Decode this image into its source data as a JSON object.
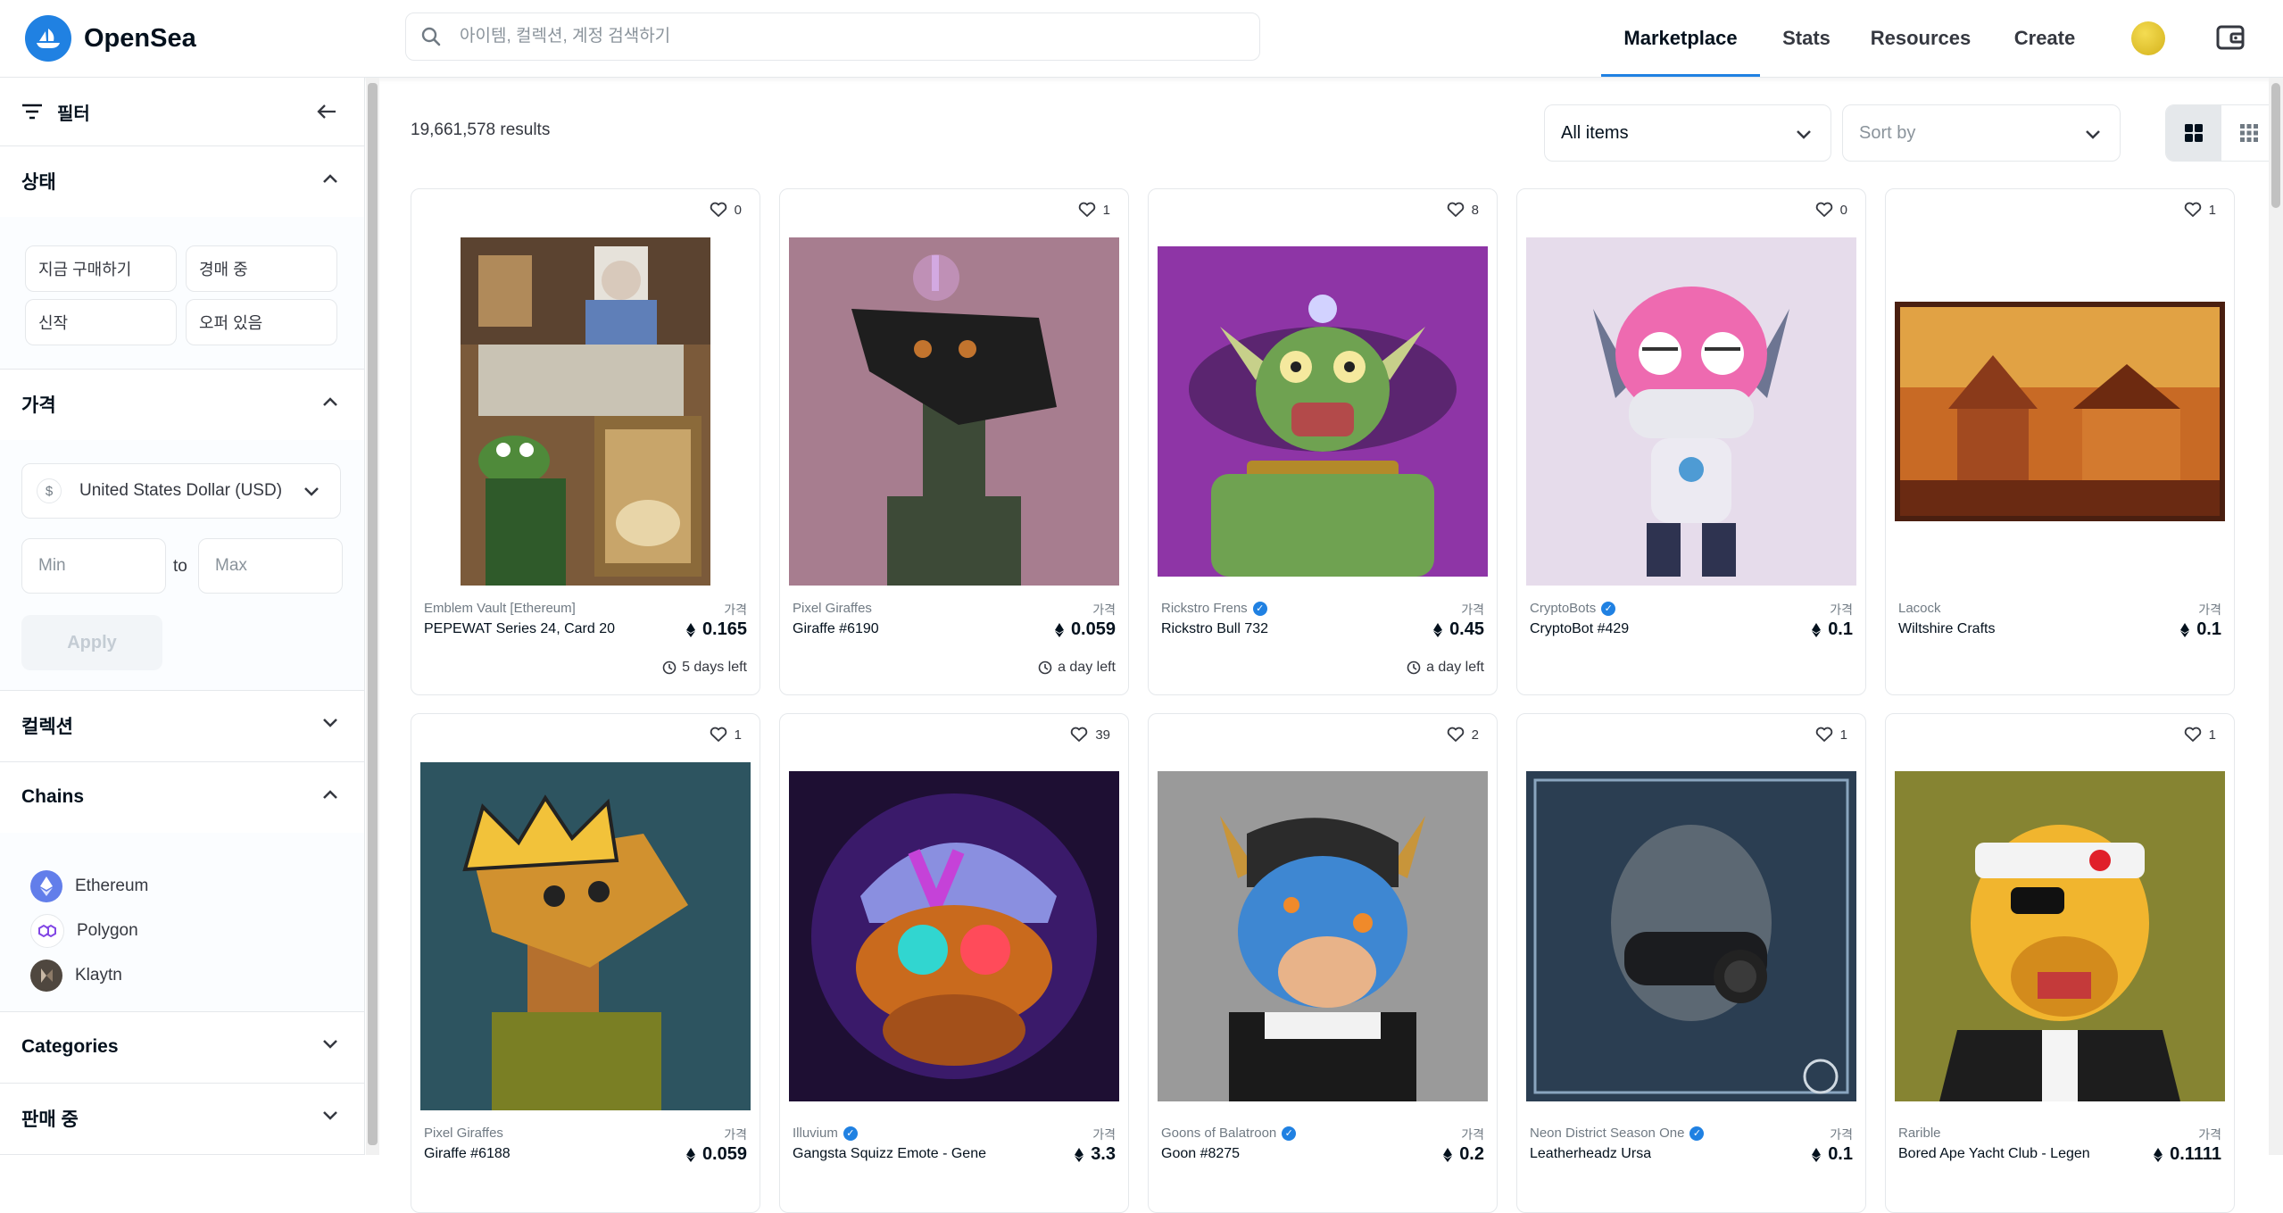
{
  "header": {
    "brand": "OpenSea",
    "search_placeholder": "아이템, 컬렉션, 계정 검색하기",
    "nav": [
      "Marketplace",
      "Stats",
      "Resources",
      "Create"
    ]
  },
  "sidebar": {
    "filter_title": "필터",
    "status": {
      "title": "상태",
      "options": [
        "지금 구매하기",
        "경매 중",
        "신작",
        "오퍼 있음"
      ]
    },
    "price": {
      "title": "가격",
      "currency": "United States Dollar (USD)",
      "currency_symbol": "$",
      "min_placeholder": "Min",
      "max_placeholder": "Max",
      "to_label": "to",
      "apply_label": "Apply"
    },
    "collections_title": "컬렉션",
    "chains": {
      "title": "Chains",
      "items": [
        "Ethereum",
        "Polygon",
        "Klaytn"
      ]
    },
    "categories_title": "Categories",
    "on_sale_title": "판매 중"
  },
  "main": {
    "results_count": "19,661,578 results",
    "items_filter": "All items",
    "sort_placeholder": "Sort by",
    "price_label": "가격",
    "cards": [
      {
        "favorites": "0",
        "collection": "Emblem Vault [Ethereum]",
        "verified": false,
        "name": "PEPEWAT Series 24, Card 20",
        "price": "0.165",
        "time_left": "5 days left",
        "image": "pepe-painting"
      },
      {
        "favorites": "1",
        "collection": "Pixel Giraffes",
        "verified": false,
        "name": "Giraffe #6190",
        "price": "0.059",
        "time_left": "a day left",
        "image": "giraffe-dark"
      },
      {
        "favorites": "8",
        "collection": "Rickstro Frens",
        "verified": true,
        "name": "Rickstro Bull 732",
        "price": "0.45",
        "time_left": "a day left",
        "image": "green-bull"
      },
      {
        "favorites": "0",
        "collection": "CryptoBots",
        "verified": true,
        "name": "CryptoBot #429",
        "price": "0.1",
        "time_left": "",
        "image": "pink-robot"
      },
      {
        "favorites": "1",
        "collection": "Lacock",
        "verified": false,
        "name": "Wiltshire Crafts",
        "price": "0.1",
        "time_left": "",
        "image": "village-photo"
      },
      {
        "favorites": "1",
        "collection": "Pixel Giraffes",
        "verified": false,
        "name": "Giraffe #6188",
        "price": "0.059",
        "time_left": "",
        "image": "giraffe-king"
      },
      {
        "favorites": "39",
        "collection": "Illuvium",
        "verified": true,
        "name": "Gangsta Squizz Emote - Gene",
        "price": "3.3",
        "time_left": "",
        "image": "squizz"
      },
      {
        "favorites": "2",
        "collection": "Goons of Balatroon",
        "verified": true,
        "name": "Goon #8275",
        "price": "0.2",
        "time_left": "",
        "image": "goon-cow"
      },
      {
        "favorites": "1",
        "collection": "Neon District Season One",
        "verified": true,
        "name": "Leatherheadz Ursa",
        "price": "0.1",
        "time_left": "",
        "image": "gas-mask"
      },
      {
        "favorites": "1",
        "collection": "Rarible",
        "verified": false,
        "name": "Bored Ape Yacht Club - Legen",
        "price": "0.1111",
        "time_left": "",
        "image": "bored-ape"
      }
    ]
  },
  "colors": {
    "accent": "#2081e2",
    "text": "#04111d",
    "muted": "#707a83",
    "border": "#e5e8eb"
  }
}
